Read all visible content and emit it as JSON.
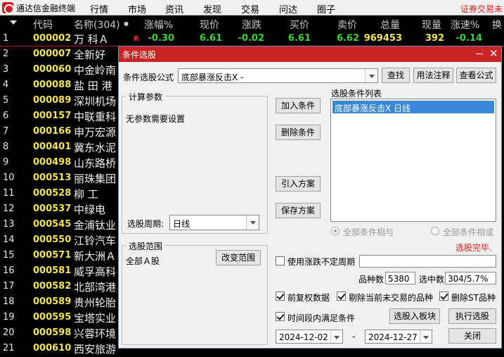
{
  "app": {
    "name": "通达信金融终端",
    "menu": [
      "行情",
      "市场",
      "资讯",
      "发现",
      "交易",
      "问达",
      "圈子"
    ],
    "right_text": "证券交易未"
  },
  "table": {
    "headers": {
      "code": "代码",
      "name": "名称(304)",
      "change_pct": "涨幅%",
      "price": "现价",
      "change": "涨跌",
      "bid": "买价",
      "ask": "卖价",
      "volume": "总量",
      "current_vol": "现量",
      "speed": "涨速%",
      "turnover": "换"
    },
    "first_row": {
      "idx": "1",
      "code": "000002",
      "name": "万 科Ａ",
      "flag": "R",
      "change_pct": "-0.30",
      "price": "6.61",
      "change": "-0.02",
      "bid": "6.61",
      "ask": "6.62",
      "volume": "969453",
      "current_vol": "392",
      "speed": "-0.14"
    },
    "rows": [
      {
        "idx": "2",
        "code": "000007",
        "name": "全新好"
      },
      {
        "idx": "3",
        "code": "000060",
        "name": "中金岭南"
      },
      {
        "idx": "4",
        "code": "000088",
        "name": "盐 田 港"
      },
      {
        "idx": "5",
        "code": "000089",
        "name": "深圳机场"
      },
      {
        "idx": "6",
        "code": "000157",
        "name": "中联重科"
      },
      {
        "idx": "7",
        "code": "000166",
        "name": "申万宏源"
      },
      {
        "idx": "8",
        "code": "000401",
        "name": "冀东水泥"
      },
      {
        "idx": "9",
        "code": "000498",
        "name": "山东路桥"
      },
      {
        "idx": "10",
        "code": "000513",
        "name": "丽珠集团"
      },
      {
        "idx": "11",
        "code": "000528",
        "name": "柳 工"
      },
      {
        "idx": "12",
        "code": "000537",
        "name": "中绿电"
      },
      {
        "idx": "13",
        "code": "000545",
        "name": "金浦钛业"
      },
      {
        "idx": "14",
        "code": "000550",
        "name": "江铃汽车"
      },
      {
        "idx": "15",
        "code": "000571",
        "name": "新大洲Ａ"
      },
      {
        "idx": "16",
        "code": "000581",
        "name": "威孚高科"
      },
      {
        "idx": "17",
        "code": "000582",
        "name": "北部湾港"
      },
      {
        "idx": "18",
        "code": "000589",
        "name": "贵州轮胎"
      },
      {
        "idx": "19",
        "code": "000595",
        "name": "宝塔实业"
      },
      {
        "idx": "20",
        "code": "000598",
        "name": "兴蓉环境"
      },
      {
        "idx": "21",
        "code": "000610",
        "name": "西安旅游"
      }
    ]
  },
  "dialog": {
    "title": "条件选股",
    "formula_label": "条件选股公式",
    "formula_value": "底部暴涨反击X  -",
    "find_button": "查找",
    "usage_button": "用法注释",
    "view_formula_button": "查看公式",
    "params_group": "计算参数",
    "no_params_text": "无参数需要设置",
    "period_label": "选股周期:",
    "period_value": "日线",
    "add_condition_button": "加入条件",
    "delete_condition_button": "删除条件",
    "import_plan_button": "引入方案",
    "save_plan_button": "保存方案",
    "condition_list_label": "选股条件列表",
    "condition_items": [
      "底部暴涨反击X  日线"
    ],
    "radio_all_and": "全部条件相与",
    "radio_all_or": "全部条件相或",
    "status_text": "选股完毕.",
    "range_group": "选股范围",
    "range_value": "全部Ａ股",
    "change_range_button": "改变范围",
    "use_uncertain_period_label": "使用涨跌不定周期",
    "uncertain_period_value": "",
    "variety_count_label": "品种数",
    "variety_count_value": "5380",
    "selected_count_label": "选中数",
    "selected_count_value": "304/5.7%",
    "prior_adjusted_label": "前复权数据",
    "exclude_untraded_label": "剔除当前未交易的品种",
    "exclude_st_label": "删除ST品种",
    "time_range_label": "时间段内满足条件",
    "to_block_button": "选股入板块",
    "execute_button": "执行选股",
    "date_from": "2024-12-02",
    "date_sep": "-",
    "date_to": "2024-12-27",
    "close_button": "关闭"
  },
  "colors": {
    "code_yellow": "#f2e64e",
    "down_green": "#39d239",
    "title_red": "#c82325",
    "status_red": "#e0201c"
  }
}
